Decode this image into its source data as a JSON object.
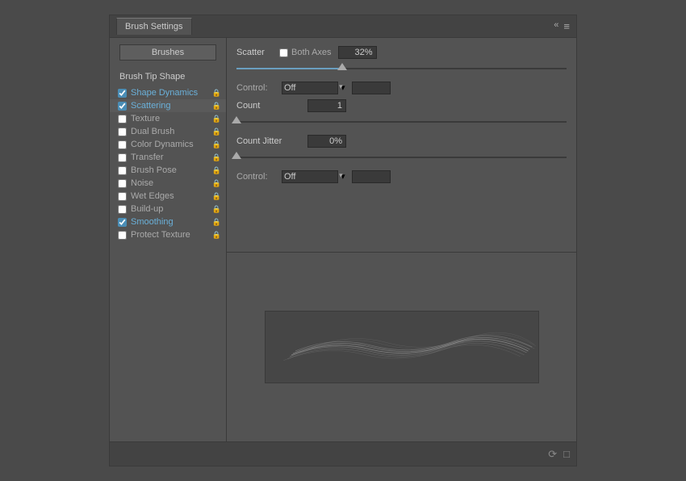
{
  "panel": {
    "title": "Brush Settings",
    "title_tab": "Brush Settings"
  },
  "sidebar": {
    "brushes_button": "Brushes",
    "brush_tip_shape": "Brush Tip Shape",
    "items": [
      {
        "label": "Shape Dynamics",
        "checked": true,
        "active": false,
        "blue": true
      },
      {
        "label": "Scattering",
        "checked": true,
        "active": true,
        "blue": true
      },
      {
        "label": "Texture",
        "checked": false,
        "active": false,
        "blue": false
      },
      {
        "label": "Dual Brush",
        "checked": false,
        "active": false,
        "blue": false
      },
      {
        "label": "Color Dynamics",
        "checked": false,
        "active": false,
        "blue": false
      },
      {
        "label": "Transfer",
        "checked": false,
        "active": false,
        "blue": false
      },
      {
        "label": "Brush Pose",
        "checked": false,
        "active": false,
        "blue": false
      },
      {
        "label": "Noise",
        "checked": false,
        "active": false,
        "blue": false
      },
      {
        "label": "Wet Edges",
        "checked": false,
        "active": false,
        "blue": false
      },
      {
        "label": "Build-up",
        "checked": false,
        "active": false,
        "blue": false
      },
      {
        "label": "Smoothing",
        "checked": true,
        "active": false,
        "blue": true
      },
      {
        "label": "Protect Texture",
        "checked": false,
        "active": false,
        "blue": false
      }
    ]
  },
  "content": {
    "scatter_label": "Scatter",
    "both_axes_label": "Both Axes",
    "scatter_value": "32%",
    "control_label": "Control:",
    "control_off": "Off",
    "count_label": "Count",
    "count_value": "1",
    "count_jitter_label": "Count Jitter",
    "count_jitter_value": "0%",
    "control2_label": "Control:",
    "control2_off": "Off"
  },
  "icons": {
    "collapse": "«",
    "close": "✕",
    "menu": "≡",
    "lock": "🔒",
    "cycle": "⟳",
    "new": "□"
  }
}
